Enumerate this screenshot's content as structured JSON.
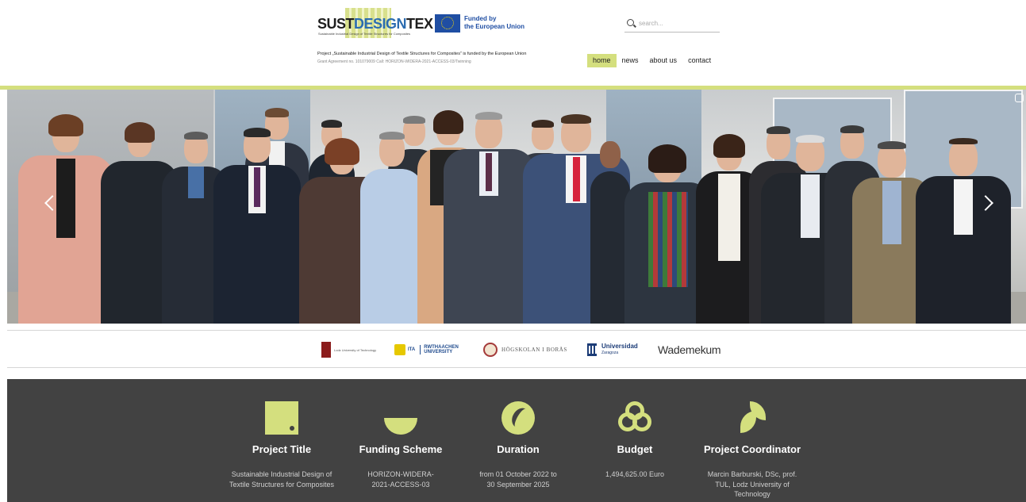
{
  "header": {
    "logo": {
      "part1": "SUST",
      "part2": "DESIGN",
      "part3": "TEX",
      "tagline": "Sustainable Industrial Design of Textile Structures for Composites"
    },
    "eu": {
      "line1": "Funded by",
      "line2": "the European Union"
    },
    "search": {
      "placeholder": "search...",
      "value": ""
    },
    "project_line": "Project „Sustainable Industrial Design of Textile Structures for Composites” is funded by the European Union",
    "grant_line": "Grant Agreement no. 101079009 Call: HORIZON-WIDERA-2021-ACCESS-03/Twinning",
    "nav": [
      {
        "label": "home",
        "active": true
      },
      {
        "label": "news",
        "active": false
      },
      {
        "label": "about us",
        "active": false
      },
      {
        "label": "contact",
        "active": false
      }
    ]
  },
  "partners": {
    "lodz": "Lodz University of Technology",
    "ita": "ITA",
    "rwth_line1": "RWTHAACHEN",
    "rwth_line2": "UNIVERSITY",
    "boras": "HÖGSKOLAN I BORÅS",
    "zaragoza_line1": "Universidad",
    "zaragoza_line2": "Zaragoza",
    "wademekum": "Wademekum"
  },
  "info": [
    {
      "icon": "square-icon",
      "title": "Project Title",
      "desc": "Sustainable Industrial Design of Textile Structures for Composites"
    },
    {
      "icon": "pie-icon",
      "title": "Funding Scheme",
      "desc": "HORIZON-WIDERA-2021-ACCESS-03"
    },
    {
      "icon": "swirl-icon",
      "title": "Duration",
      "desc": "from 01 October 2022 to 30 September 2025"
    },
    {
      "icon": "rings-icon",
      "title": "Budget",
      "desc": "1,494,625.00 Euro"
    },
    {
      "icon": "leaf-icon",
      "title": "Project Coordinator",
      "desc": "Marcin Barburski, DSc, prof. TUL, Lodz University of Technology"
    }
  ],
  "colors": {
    "accent": "#d4df7e",
    "band": "#424242",
    "eu_blue": "#1f4ea3"
  }
}
